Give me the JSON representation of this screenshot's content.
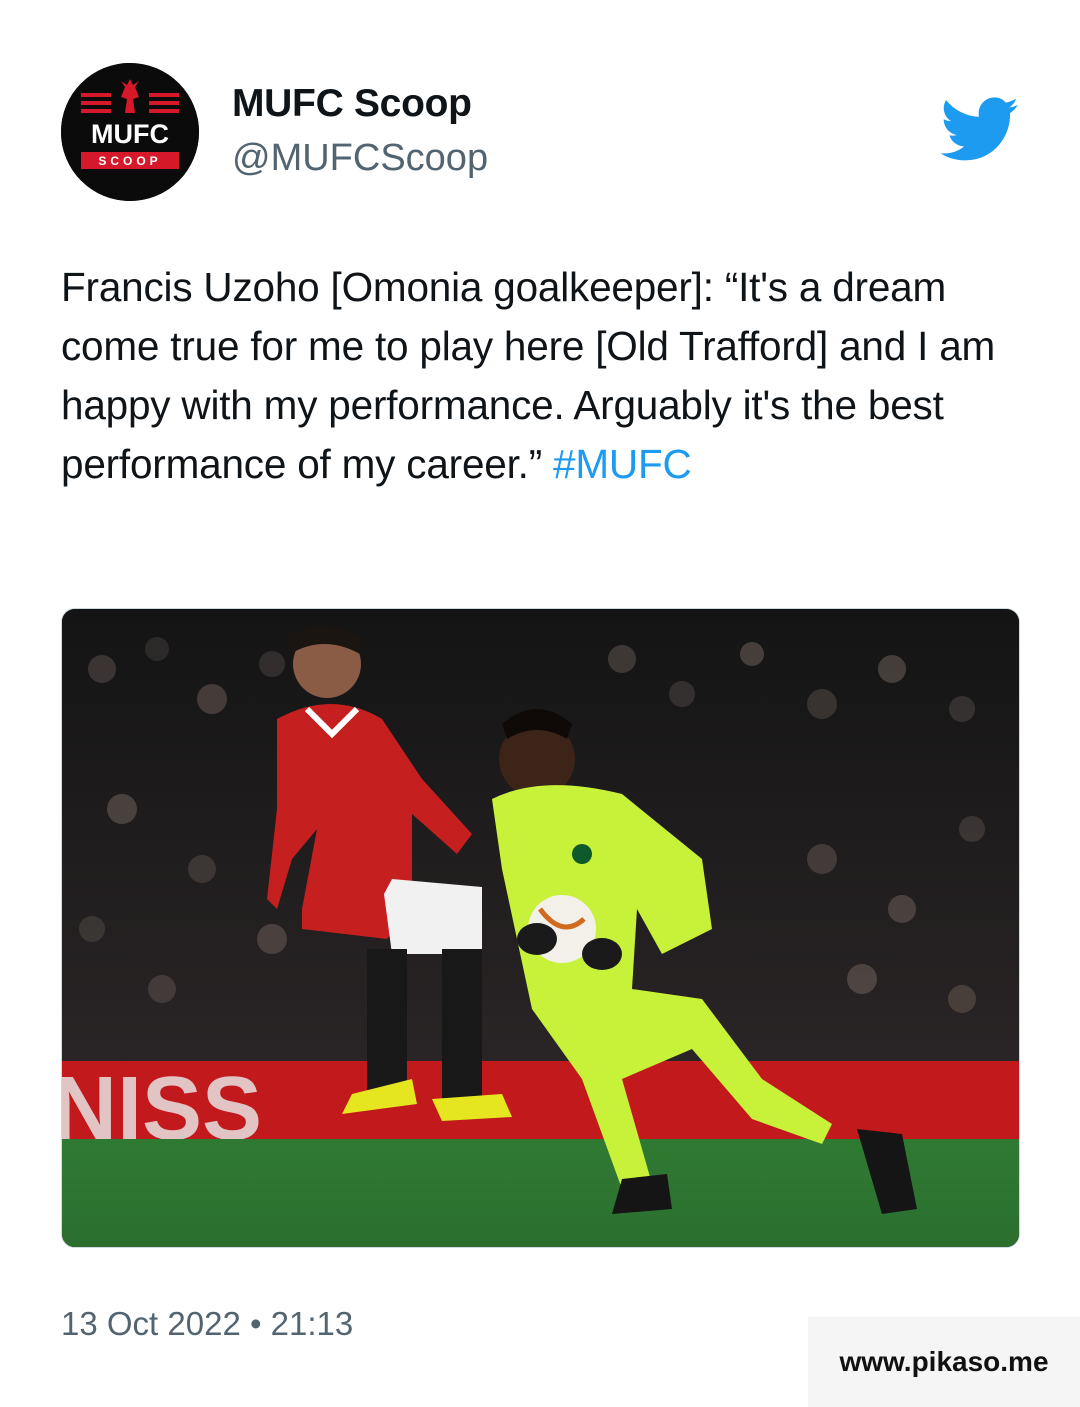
{
  "author": {
    "display_name": "MUFC Scoop",
    "handle": "@MUFCScoop",
    "avatar": {
      "line1": "MUFC",
      "line2": "SCOOP",
      "brand_red": "#d5192b",
      "bg": "#0b0b0b"
    }
  },
  "icons": {
    "platform": "twitter-bird-icon"
  },
  "tweet": {
    "text": "Francis Uzoho [Omonia goalkeeper]: “It's a dream come true for me to play here [Old Trafford] and I am happy with my performance. Arguably it's the best performance of my career.” ",
    "hashtag": "#MUFC",
    "hashtag_color": "#1d9bf0"
  },
  "media": {
    "kind": "photo",
    "subject": "football-match"
  },
  "meta": {
    "timestamp": "13 Oct 2022 • 21:13"
  },
  "watermark": {
    "text": "www.pikaso.me"
  },
  "colors": {
    "twitter_blue": "#1d9bf0",
    "text": "#0f1419",
    "secondary": "#536471"
  }
}
